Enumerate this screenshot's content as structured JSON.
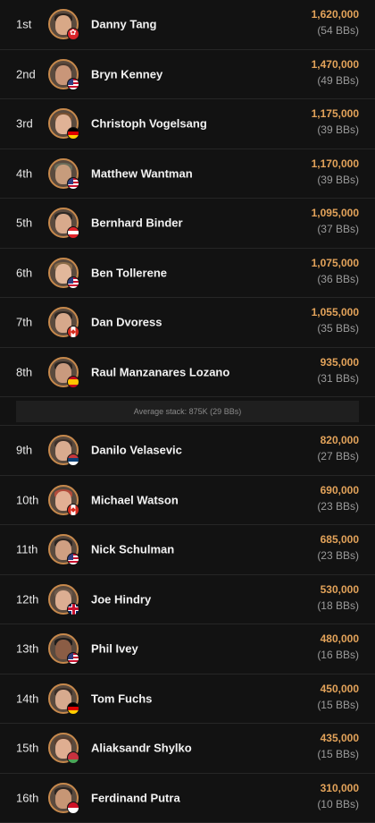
{
  "players_top": [
    {
      "rank": "1st",
      "name": "Danny Tang",
      "chips": "1,620,000",
      "bbs": "(54 BBs)",
      "flag": "f-hk",
      "flag_icon": "hong-kong-flag-icon",
      "skin": "#d8a887",
      "hair": "#2a211c"
    },
    {
      "rank": "2nd",
      "name": "Bryn Kenney",
      "chips": "1,470,000",
      "bbs": "(49 BBs)",
      "flag": "f-us",
      "flag_icon": "usa-flag-icon",
      "skin": "#c99679",
      "hair": "#4b3a30"
    },
    {
      "rank": "3rd",
      "name": "Christoph Vogelsang",
      "chips": "1,175,000",
      "bbs": "(39 BBs)",
      "flag": "f-de",
      "flag_icon": "germany-flag-icon",
      "skin": "#e0b296",
      "hair": "#7a5233"
    },
    {
      "rank": "4th",
      "name": "Matthew Wantman",
      "chips": "1,170,000",
      "bbs": "(39 BBs)",
      "flag": "f-us",
      "flag_icon": "usa-flag-icon",
      "skin": "#c79c7c",
      "hair": "#6b6d5a"
    },
    {
      "rank": "5th",
      "name": "Bernhard Binder",
      "chips": "1,095,000",
      "bbs": "(37 BBs)",
      "flag": "f-at",
      "flag_icon": "austria-flag-icon",
      "skin": "#d8aa8c",
      "hair": "#2d2824"
    },
    {
      "rank": "6th",
      "name": "Ben Tollerene",
      "chips": "1,075,000",
      "bbs": "(36 BBs)",
      "flag": "f-us",
      "flag_icon": "usa-flag-icon",
      "skin": "#e1b79b",
      "hair": "#8b6c48"
    },
    {
      "rank": "7th",
      "name": "Dan Dvoress",
      "chips": "1,055,000",
      "bbs": "(35 BBs)",
      "flag": "f-ca",
      "flag_icon": "canada-flag-icon",
      "skin": "#d6a88b",
      "hair": "#2e2621"
    },
    {
      "rank": "8th",
      "name": "Raul Manzanares Lozano",
      "chips": "935,000",
      "bbs": "(31 BBs)",
      "flag": "f-es",
      "flag_icon": "spain-flag-icon",
      "skin": "#c99a7e",
      "hair": "#2b2420"
    }
  ],
  "average_stack": "Average stack: 875K (29 BBs)",
  "players_bottom": [
    {
      "rank": "9th",
      "name": "Danilo Velasevic",
      "chips": "820,000",
      "bbs": "(27 BBs)",
      "flag": "f-rs",
      "flag_icon": "serbia-flag-icon",
      "skin": "#d9ab8f",
      "hair": "#3e302a"
    },
    {
      "rank": "10th",
      "name": "Michael Watson",
      "chips": "690,000",
      "bbs": "(23 BBs)",
      "flag": "f-ca",
      "flag_icon": "canada-flag-icon",
      "skin": "#e2b094",
      "hair": "#b24b3a"
    },
    {
      "rank": "11th",
      "name": "Nick Schulman",
      "chips": "685,000",
      "bbs": "(23 BBs)",
      "flag": "f-us",
      "flag_icon": "usa-flag-icon",
      "skin": "#cf9f82",
      "hair": "#2b2522"
    },
    {
      "rank": "12th",
      "name": "Joe Hindry",
      "chips": "530,000",
      "bbs": "(18 BBs)",
      "flag": "f-gb",
      "flag_icon": "uk-flag-icon",
      "skin": "#dcae92",
      "hair": "#6e5a4b"
    },
    {
      "rank": "13th",
      "name": "Phil Ivey",
      "chips": "480,000",
      "bbs": "(16 BBs)",
      "flag": "f-us",
      "flag_icon": "usa-flag-icon",
      "skin": "#8b5d45",
      "hair": "#1c1c1c"
    },
    {
      "rank": "14th",
      "name": "Tom Fuchs",
      "chips": "450,000",
      "bbs": "(15 BBs)",
      "flag": "f-de",
      "flag_icon": "germany-flag-icon",
      "skin": "#d7aa8e",
      "hair": "#3a2e27"
    },
    {
      "rank": "15th",
      "name": "Aliaksandr Shylko",
      "chips": "435,000",
      "bbs": "(15 BBs)",
      "flag": "f-by",
      "flag_icon": "belarus-flag-icon",
      "skin": "#dfae91",
      "hair": "#5a3f2f"
    },
    {
      "rank": "16th",
      "name": "Ferdinand Putra",
      "chips": "310,000",
      "bbs": "(10 BBs)",
      "flag": "f-id",
      "flag_icon": "indonesia-flag-icon",
      "skin": "#c79675",
      "hair": "#2b2522"
    }
  ]
}
